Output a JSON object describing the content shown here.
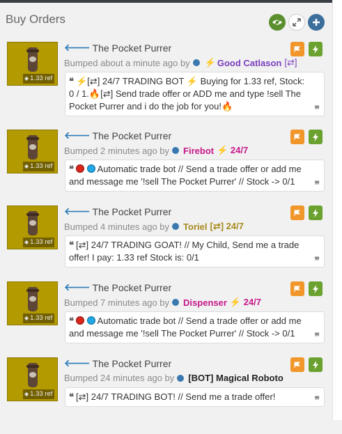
{
  "panel": {
    "title": "Buy Orders",
    "buttons": [
      "eye-icon",
      "expand-icon",
      "plus-icon"
    ]
  },
  "colors": {
    "accent_blue": "#3c6e9c",
    "eye_green": "#5a8f2e",
    "flag_orange": "#f0962a",
    "bolt_green": "#6aa12f",
    "thumb_gold": "#b39a00",
    "user_purple": "#7b3fbe",
    "user_pink": "#c6188a",
    "user_tan": "#a88a1d",
    "user_black": "#222222"
  },
  "listings": [
    {
      "item": "The Pocket Purrer",
      "price": "1.33 ref",
      "bumped": "Bumped about a minute ago by",
      "user": "Good Catlason",
      "user_prefix": "⚡",
      "user_suffix": "[⇄]",
      "message": "⚡[⇄] 24/7 TRADING BOT ⚡ Buying for 1.33 ref, Stock: 0 / 1.🔥[⇄] Send trade offer or ADD me and type !sell The Pocket Purrer and i do the job for you!🔥"
    },
    {
      "item": "The Pocket Purrer",
      "price": "1.33 ref",
      "bumped": "Bumped 2 minutes ago by",
      "user": "Firebot",
      "user_prefix": "",
      "user_suffix": "⚡ 24/7",
      "message": "Automatic trade bot // Send a trade offer or add me and message me '!sell The Pocket Purrer' // Stock -> 0/1"
    },
    {
      "item": "The Pocket Purrer",
      "price": "1.33 ref",
      "bumped": "Bumped 4 minutes ago by",
      "user": "Toriel",
      "user_prefix": "",
      "user_suffix": "[⇄] 24/7",
      "message": "[⇄] 24/7 TRADING GOAT! // My Child, Send me a trade offer! I pay: 1.33 ref Stock is: 0/1"
    },
    {
      "item": "The Pocket Purrer",
      "price": "1.33 ref",
      "bumped": "Bumped 7 minutes ago by",
      "user": "Dispenser",
      "user_prefix": "",
      "user_suffix": "⚡ 24/7",
      "message": "Automatic trade bot // Send a trade offer or add me and message me '!sell The Pocket Purrer' // Stock -> 0/1"
    },
    {
      "item": "The Pocket Purrer",
      "price": "1.33 ref",
      "bumped": "Bumped 24 minutes ago by",
      "user": "[BOT] Magical Roboto",
      "user_prefix": "",
      "user_suffix": "",
      "message": "[⇄] 24/7 TRADING BOT! // Send me a trade offer!"
    }
  ]
}
